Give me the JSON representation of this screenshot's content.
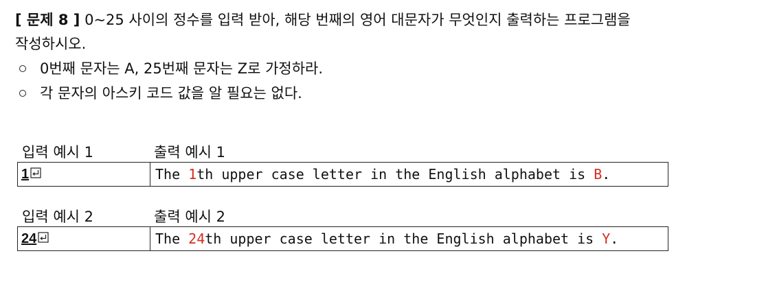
{
  "problem": {
    "header": "[ 문제 8 ]",
    "text_line1": "0~25 사이의 정수를 입력 받아, 해당 번째의 영어 대문자가 무엇인지 출력하는 프로그램을",
    "text_line2": "작성하시오.",
    "bullets": [
      "0번째 문자는 A, 25번째 문자는 Z로 가정하라.",
      "각 문자의 아스키 코드 값을 알 필요는 없다."
    ]
  },
  "colors": {
    "highlight": "#d62b1f",
    "border": "#222222"
  },
  "icons": {
    "enter": "enter-return-icon",
    "bullet": "hollow-circle-bullet"
  },
  "examples": [
    {
      "input_label": "입력 예시 1",
      "output_label": "출력 예시 1",
      "input_value": "1",
      "output_prefix": "The ",
      "output_num": "1",
      "output_middle": "th upper case letter in the English alphabet is ",
      "output_letter": "B",
      "output_suffix": "."
    },
    {
      "input_label": "입력 예시 2",
      "output_label": "출력 예시 2",
      "input_value": "24",
      "output_prefix": "The ",
      "output_num": "24",
      "output_middle": "th upper case letter in the English alphabet is ",
      "output_letter": "Y",
      "output_suffix": "."
    }
  ]
}
